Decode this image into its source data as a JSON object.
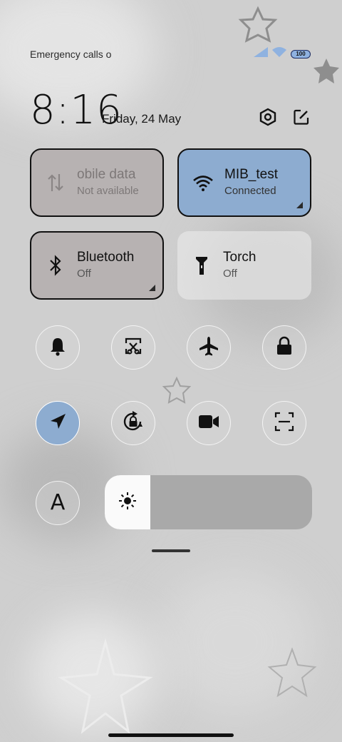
{
  "status_bar": {
    "carrier_text": "Emergency calls o",
    "battery_level": "100",
    "icons": [
      "signal-icon",
      "wifi-icon",
      "battery-icon"
    ]
  },
  "header": {
    "time": "8:16",
    "date": "Friday, 24 May",
    "icons": [
      "settings-icon",
      "edit-icon"
    ]
  },
  "tiles": {
    "mobile_data": {
      "title": "obile data",
      "status": "Not available",
      "icon": "data-arrows-icon"
    },
    "wifi": {
      "title": "MIB_test",
      "status": "Connected",
      "icon": "wifi-icon"
    },
    "bluetooth": {
      "title": "Bluetooth",
      "status": "Off",
      "icon": "bluetooth-icon"
    },
    "torch": {
      "title": "Torch",
      "status": "Off",
      "icon": "flashlight-icon"
    }
  },
  "toggles_row1": [
    "bell-icon",
    "screenshot-icon",
    "airplane-icon",
    "lock-icon"
  ],
  "toggles_row2": [
    "location-icon",
    "rotation-lock-icon",
    "video-icon",
    "scanner-icon"
  ],
  "toggles_row3": [
    "font-icon"
  ],
  "font_toggle_label": "A",
  "brightness": {
    "level_fraction": 0.22,
    "icon": "sun-icon"
  },
  "colors": {
    "accent_blue": "#8dacd0",
    "tile_gray": "#b7b2b2",
    "background": "#cfcfcf"
  }
}
